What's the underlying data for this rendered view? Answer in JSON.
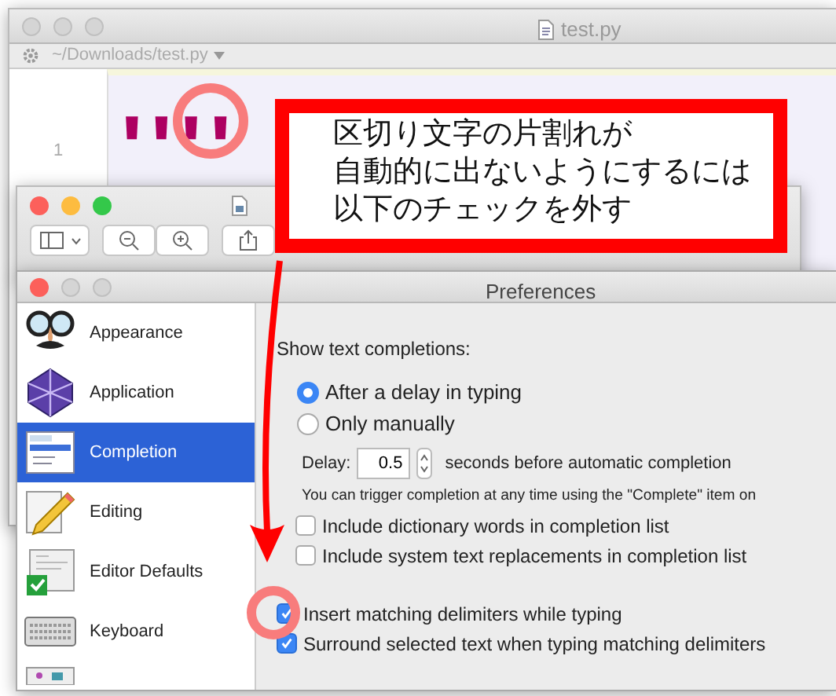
{
  "editor": {
    "title": "test.py",
    "path": "~/Downloads/test.py",
    "line_numbers": [
      "1"
    ],
    "code_line": "''''"
  },
  "preferences": {
    "title": "Preferences",
    "sidebar": [
      {
        "label": "Appearance",
        "selected": false
      },
      {
        "label": "Application",
        "selected": false
      },
      {
        "label": "Completion",
        "selected": true
      },
      {
        "label": "Editing",
        "selected": false
      },
      {
        "label": "Editor Defaults",
        "selected": false
      },
      {
        "label": "Keyboard",
        "selected": false
      }
    ],
    "section_label": "Show text completions:",
    "radios": [
      {
        "label": "After a delay in typing",
        "selected": true
      },
      {
        "label": "Only manually",
        "selected": false
      }
    ],
    "delay": {
      "label": "Delay:",
      "value": "0.5",
      "suffix": "seconds before automatic completion"
    },
    "info": "You can trigger completion at any time using the \"Complete\" item on",
    "completion_options": [
      {
        "label": "Include dictionary words in completion list",
        "checked": false
      },
      {
        "label": "Include system text replacements in completion list",
        "checked": false
      }
    ],
    "delimiter_options": [
      {
        "label": "Insert matching delimiters while typing",
        "checked": true
      },
      {
        "label": "Surround selected text when typing matching delimiters",
        "checked": true
      }
    ]
  },
  "annotation": {
    "lines": [
      "区切り文字の片割れが",
      "自動的に出ないようにするには",
      "以下のチェックを外す"
    ]
  }
}
